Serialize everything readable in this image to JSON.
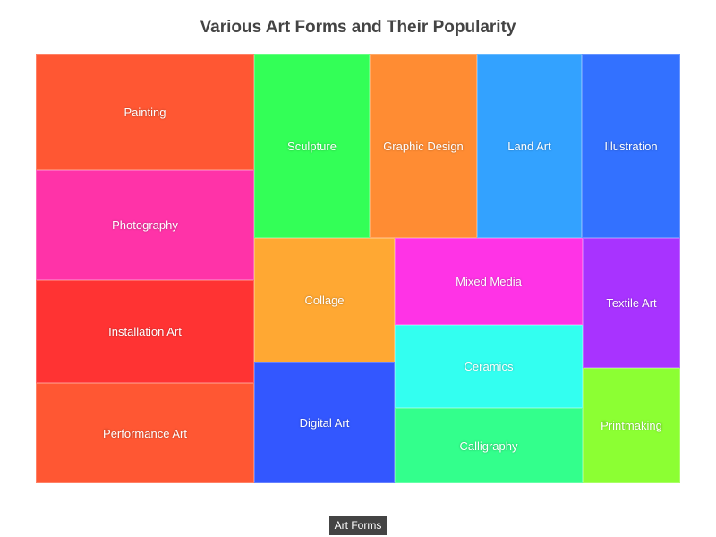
{
  "chart_data": {
    "type": "treemap",
    "title": "Various Art Forms and Their Popularity",
    "legend": {
      "label": "Art Forms",
      "placement": "bottom-center"
    },
    "items": [
      {
        "name": "Painting",
        "value": 88,
        "color": "#ff5733"
      },
      {
        "name": "Photography",
        "value": 85,
        "color": "#ff33a8"
      },
      {
        "name": "Installation Art",
        "value": 78,
        "color": "#ff3333"
      },
      {
        "name": "Performance Art",
        "value": 77,
        "color": "#ff5733"
      },
      {
        "name": "Sculpture",
        "value": 75,
        "color": "#33ff57"
      },
      {
        "name": "Graphic Design",
        "value": 72,
        "color": "#ff8c33"
      },
      {
        "name": "Land Art",
        "value": 70,
        "color": "#33a2ff"
      },
      {
        "name": "Illustration",
        "value": 70,
        "color": "#3371ff"
      },
      {
        "name": "Collage",
        "value": 68,
        "color": "#ffa833"
      },
      {
        "name": "Digital Art",
        "value": 67,
        "color": "#3357ff"
      },
      {
        "name": "Mixed Media",
        "value": 60,
        "color": "#ff33e6"
      },
      {
        "name": "Ceramics",
        "value": 57,
        "color": "#33fff0"
      },
      {
        "name": "Calligraphy",
        "value": 53,
        "color": "#33ff8c"
      },
      {
        "name": "Textile Art",
        "value": 50,
        "color": "#a833ff"
      },
      {
        "name": "Printmaking",
        "value": 45,
        "color": "#8cff33"
      }
    ]
  }
}
